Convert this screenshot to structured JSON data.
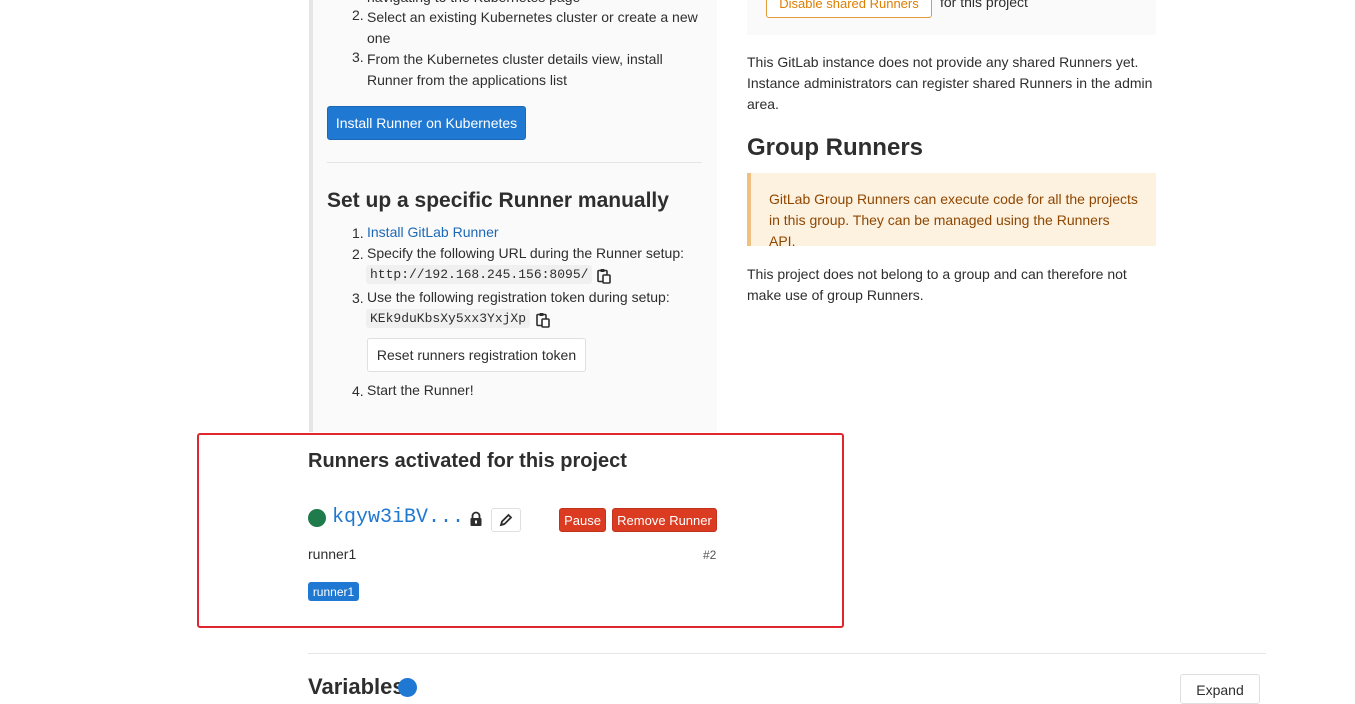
{
  "left": {
    "partial_step_1": "navigating to the Kubernetes page",
    "step_2": "Select an existing Kubernetes cluster or create a new one",
    "step_3": "From the Kubernetes cluster details view, install Runner from the applications list",
    "install_k8s_button": "Install Runner on Kubernetes",
    "manual_title": "Set up a specific Runner manually",
    "manual_steps": {
      "s1_link": "Install GitLab Runner",
      "s2_text": "Specify the following URL during the Runner setup:",
      "s2_url": "http://192.168.245.156:8095/",
      "s3_text": "Use the following registration token during setup:",
      "s3_token": "KEk9duKbsXy5xx3YxjXp",
      "reset_button": "Reset runners registration token",
      "s4_text": "Start the Runner!"
    },
    "numbers": [
      "2.",
      "3.",
      "1.",
      "2.",
      "3.",
      "4."
    ]
  },
  "right": {
    "disable_shared_button": "Disable shared Runners",
    "disable_shared_suffix": "for this project",
    "shared_info": "This GitLab instance does not provide any shared Runners yet. Instance administrators can register shared Runners in the admin area.",
    "group_title": "Group Runners",
    "group_notice": "GitLab Group Runners can execute code for all the projects in this group. They can be managed using the Runners API.",
    "group_info": "This project does not belong to a group and can therefore not make use of group Runners."
  },
  "activated": {
    "title": "Runners activated for this project",
    "runner": {
      "token": "kqyw3iBV...",
      "pause_button": "Pause",
      "remove_button": "Remove Runner",
      "description": "runner1",
      "id": "#2",
      "tag": "runner1",
      "status_color": "#1f7a4c"
    }
  },
  "variables": {
    "title": "Variables",
    "expand_button": "Expand"
  },
  "colors": {
    "primary": "#1f78d1",
    "danger": "#db3b21",
    "warning": "#de7e00",
    "highlight": "#e0262e"
  }
}
